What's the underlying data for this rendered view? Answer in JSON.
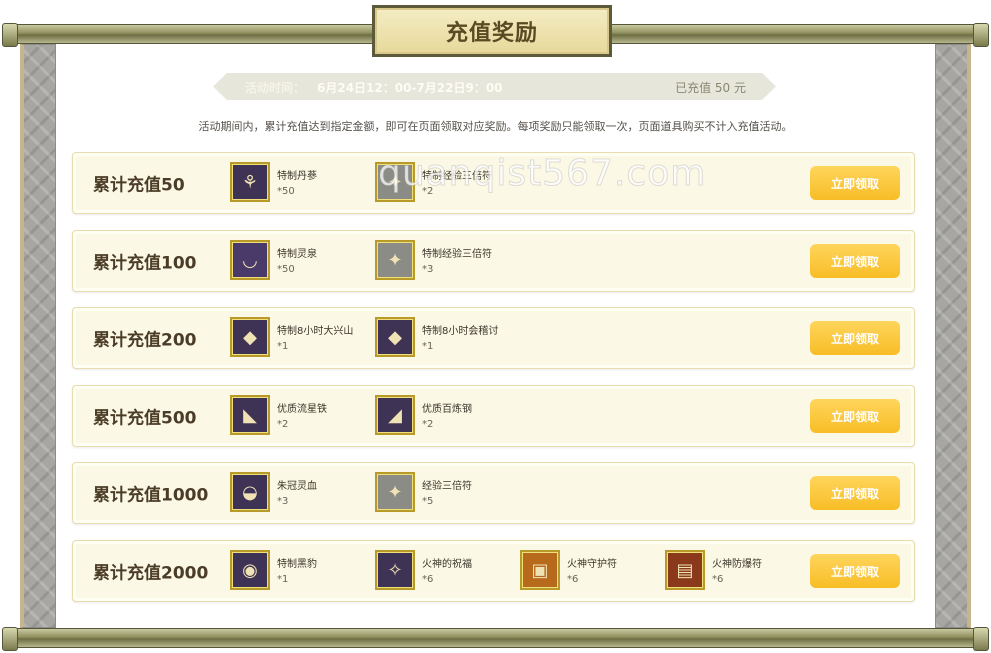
{
  "title": "充值奖励",
  "info": {
    "time_label": "活动时间：",
    "time_value": "6月24日12：00-7月22日9：00",
    "charged": "已充值 50 元"
  },
  "description": "活动期间内，累计充值达到指定金额，即可在页面领取对应奖励。每项奖励只能领取一次，页面道具购买不计入充值活动。",
  "claim_label": "立即领取",
  "watermark": "quanqist567.com",
  "tiers": [
    {
      "title": "累计充值50",
      "items": [
        {
          "name": "特制丹蔘",
          "qty": "*50",
          "icon": "ginseng-icon"
        },
        {
          "name": "特制经验三倍符",
          "qty": "*2",
          "icon": "exp-charm-icon"
        }
      ]
    },
    {
      "title": "累计充值100",
      "items": [
        {
          "name": "特制灵泉",
          "qty": "*50",
          "icon": "spring-bowl-icon"
        },
        {
          "name": "特制经验三倍符",
          "qty": "*3",
          "icon": "exp-charm-icon"
        }
      ]
    },
    {
      "title": "累计充值200",
      "items": [
        {
          "name": "特制8小时大兴山",
          "qty": "*1",
          "icon": "token-icon"
        },
        {
          "name": "特制8小时会稽讨",
          "qty": "*1",
          "icon": "token-icon"
        }
      ]
    },
    {
      "title": "累计充值500",
      "items": [
        {
          "name": "优质流星铁",
          "qty": "*2",
          "icon": "meteor-iron-icon"
        },
        {
          "name": "优质百炼钢",
          "qty": "*2",
          "icon": "steel-icon"
        }
      ]
    },
    {
      "title": "累计充值1000",
      "items": [
        {
          "name": "朱冠灵血",
          "qty": "*3",
          "icon": "blood-bowl-icon"
        },
        {
          "name": "经验三倍符",
          "qty": "*5",
          "icon": "exp-charm-icon"
        }
      ]
    },
    {
      "title": "累计充值2000",
      "items": [
        {
          "name": "特制黑豹",
          "qty": "*1",
          "icon": "panther-icon"
        },
        {
          "name": "火神的祝福",
          "qty": "*6",
          "icon": "fire-blessing-icon"
        },
        {
          "name": "火神守护符",
          "qty": "*6",
          "icon": "fire-guard-charm-icon"
        },
        {
          "name": "火神防爆符",
          "qty": "*6",
          "icon": "fire-blast-charm-icon"
        }
      ]
    }
  ]
}
